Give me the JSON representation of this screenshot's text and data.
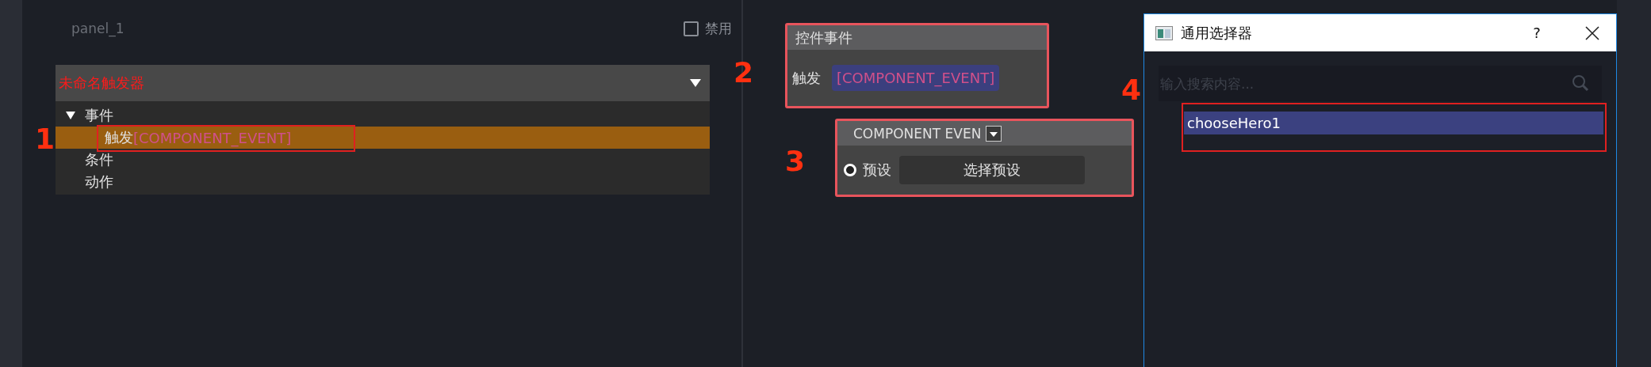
{
  "panel": {
    "title": "panel_1",
    "disable_option": {
      "label": "禁用",
      "checked": false
    }
  },
  "trigger": {
    "name": "未命名触发器",
    "tree": [
      {
        "label": "事件",
        "expanded": true,
        "selected": false,
        "children": [
          {
            "label": "触发",
            "value": "[COMPONENT_EVENT]",
            "selected": true
          }
        ]
      },
      {
        "label": "条件",
        "selected": false
      },
      {
        "label": "动作",
        "selected": false
      }
    ]
  },
  "event_node": {
    "title": "控件事件",
    "field_label": "触发",
    "value": "[COMPONENT_EVENT]"
  },
  "preset_node": {
    "title": "COMPONENT EVEN",
    "radio": {
      "label": "预设",
      "checked": true
    },
    "button": "选择预设"
  },
  "dialog": {
    "title": "通用选择器",
    "help": "?",
    "search": {
      "placeholder": "输入搜索内容..."
    },
    "items": [
      {
        "label": "chooseHero1",
        "selected": true
      }
    ]
  },
  "annotations": [
    {
      "label": "1"
    },
    {
      "label": "2"
    },
    {
      "label": "3"
    },
    {
      "label": "4"
    }
  ]
}
